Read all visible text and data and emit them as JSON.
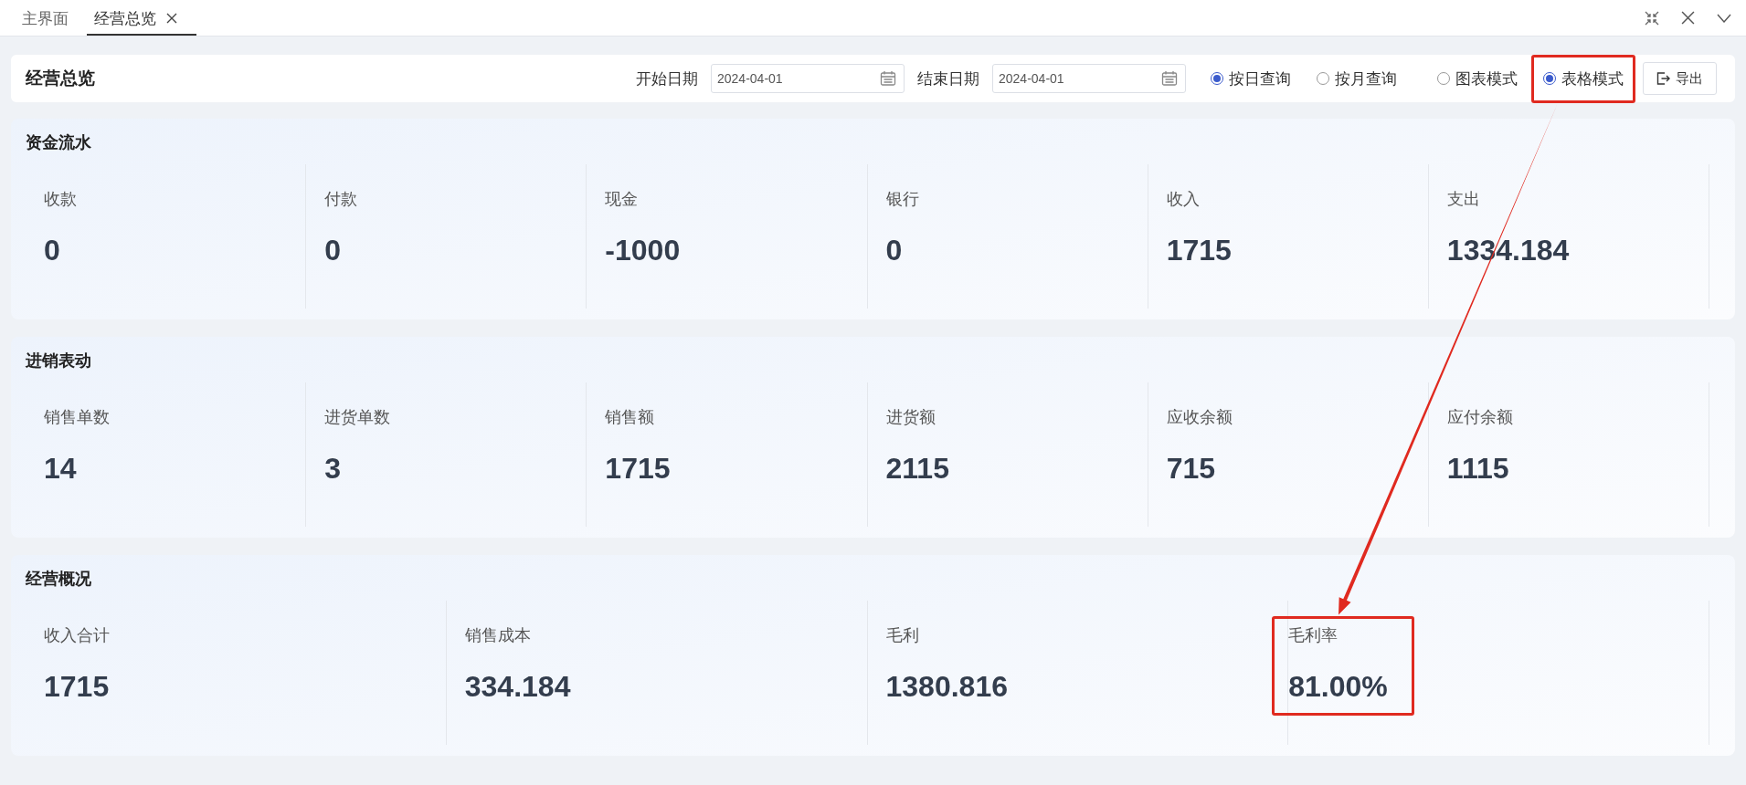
{
  "tabs": [
    {
      "label": "主界面",
      "selected": false,
      "closable": false
    },
    {
      "label": "经营总览",
      "selected": true,
      "closable": true
    }
  ],
  "toolbar": {
    "title": "经营总览",
    "start_date": {
      "label": "开始日期",
      "value": "2024-04-01"
    },
    "end_date": {
      "label": "结束日期",
      "value": "2024-04-01"
    },
    "query_mode": [
      {
        "label": "按日查询",
        "selected": true,
        "highlighted": false
      },
      {
        "label": "按月查询",
        "selected": false,
        "highlighted": false
      }
    ],
    "view_mode": [
      {
        "label": "图表模式",
        "selected": false,
        "highlighted": false
      },
      {
        "label": "表格模式",
        "selected": true,
        "highlighted": true
      }
    ],
    "export_button": "导出"
  },
  "sections": [
    {
      "title": "资金流水",
      "stats": [
        {
          "label": "收款",
          "value": "0",
          "highlighted": false
        },
        {
          "label": "付款",
          "value": "0",
          "highlighted": false
        },
        {
          "label": "现金",
          "value": "-1000",
          "highlighted": false
        },
        {
          "label": "银行",
          "value": "0",
          "highlighted": false
        },
        {
          "label": "收入",
          "value": "1715",
          "highlighted": false
        },
        {
          "label": "支出",
          "value": "1334.184",
          "highlighted": false
        }
      ]
    },
    {
      "title": "进销表动",
      "stats": [
        {
          "label": "销售单数",
          "value": "14",
          "highlighted": false
        },
        {
          "label": "进货单数",
          "value": "3",
          "highlighted": false
        },
        {
          "label": "销售额",
          "value": "1715",
          "highlighted": false
        },
        {
          "label": "进货额",
          "value": "2115",
          "highlighted": false
        },
        {
          "label": "应收余额",
          "value": "715",
          "highlighted": false
        },
        {
          "label": "应付余额",
          "value": "1115",
          "highlighted": false
        }
      ]
    },
    {
      "title": "经营概况",
      "stats": [
        {
          "label": "收入合计",
          "value": "1715",
          "highlighted": false
        },
        {
          "label": "销售成本",
          "value": "334.184",
          "highlighted": false
        },
        {
          "label": "毛利",
          "value": "1380.816",
          "highlighted": false
        },
        {
          "label": "毛利率",
          "value": "81.00%",
          "highlighted": true
        }
      ]
    }
  ]
}
